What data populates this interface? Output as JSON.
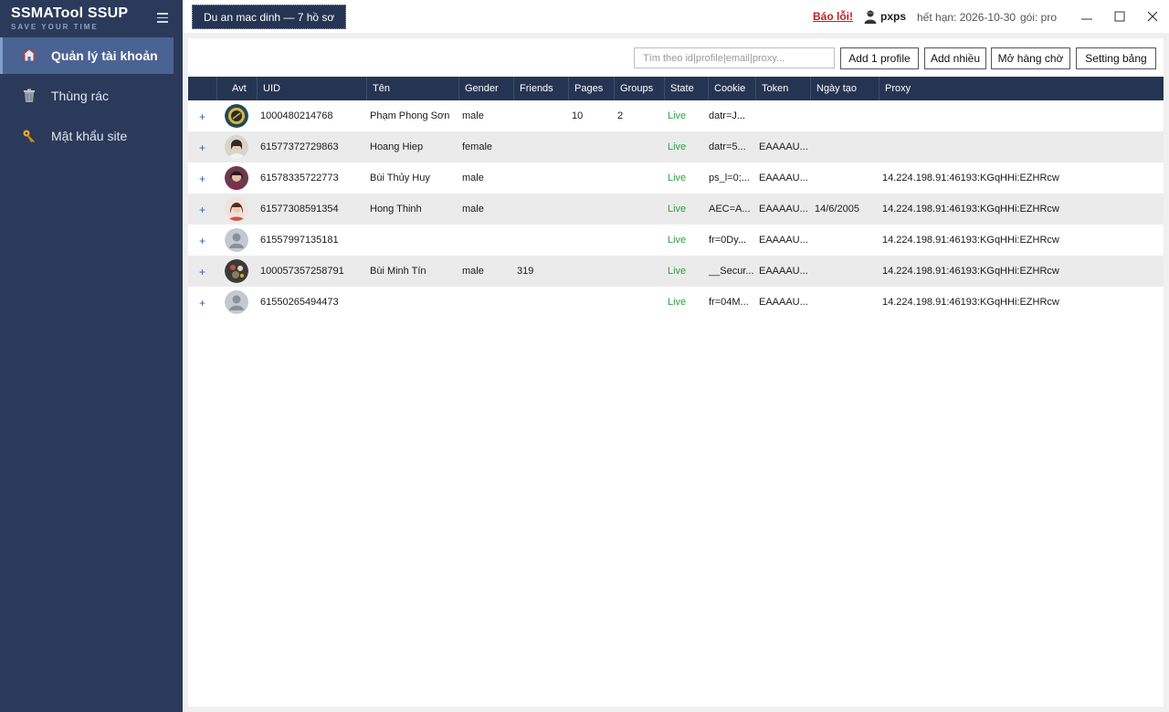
{
  "app": {
    "title": "SSMATool SSUP",
    "subtitle": "SAVE YOUR TIME"
  },
  "sidebar": {
    "items": [
      {
        "label": "Quản lý tài khoản",
        "icon": "home-icon",
        "active": true
      },
      {
        "label": "Thùng rác",
        "icon": "trash-icon",
        "active": false
      },
      {
        "label": "Mật khẩu site",
        "icon": "key-icon",
        "active": false
      }
    ]
  },
  "topbar": {
    "project_tab": "Du an mac dinh — 7 hồ sơ",
    "report_label": "Báo lỗi!",
    "username": "pxps",
    "expire": "hết hạn: 2026-10-30",
    "plan": "gói: pro"
  },
  "toolbar": {
    "search_placeholder": "Tìm theo id|profile|email|proxy...",
    "add_one": "Add 1 profile",
    "add_many": "Add nhiều",
    "open_queue": "Mở hàng chờ",
    "table_settings": "Setting bảng"
  },
  "table": {
    "columns": [
      "",
      "Avt",
      "UID",
      "Tên",
      "Gender",
      "Friends",
      "Pages",
      "Groups",
      "State",
      "Cookie",
      "Token",
      "Ngày tạo",
      "Proxy"
    ],
    "expand_symbol": "+",
    "rows": [
      {
        "uid": "1000480214768",
        "name": "Phạm Phong Sơn",
        "gender": "male",
        "friends": "",
        "pages": "10",
        "groups": "2",
        "state": "Live",
        "cookie": "datr=J...",
        "token": "",
        "created": "",
        "proxy": "",
        "avatar": "avatar-1"
      },
      {
        "uid": "61577372729863",
        "name": "Hoang Hiep",
        "gender": "female",
        "friends": "",
        "pages": "",
        "groups": "",
        "state": "Live",
        "cookie": "datr=5...",
        "token": "EAAAAU...",
        "created": "",
        "proxy": "",
        "avatar": "avatar-2"
      },
      {
        "uid": "61578335722773",
        "name": "Bùi Thủy Huy",
        "gender": "male",
        "friends": "",
        "pages": "",
        "groups": "",
        "state": "Live",
        "cookie": "ps_l=0;...",
        "token": "EAAAAU...",
        "created": "",
        "proxy": "14.224.198.91:46193:KGqHHi:EZHRcw",
        "avatar": "avatar-3"
      },
      {
        "uid": "61577308591354",
        "name": "Hong Thinh",
        "gender": "male",
        "friends": "",
        "pages": "",
        "groups": "",
        "state": "Live",
        "cookie": "AEC=A...",
        "token": "EAAAAU...",
        "created": "14/6/2005",
        "proxy": "14.224.198.91:46193:KGqHHi:EZHRcw",
        "avatar": "avatar-4"
      },
      {
        "uid": "61557997135181",
        "name": "",
        "gender": "",
        "friends": "",
        "pages": "",
        "groups": "",
        "state": "Live",
        "cookie": "fr=0Dy...",
        "token": "EAAAAU...",
        "created": "",
        "proxy": "14.224.198.91:46193:KGqHHi:EZHRcw",
        "avatar": "default-avatar"
      },
      {
        "uid": "100057357258791",
        "name": "Bùi Minh Tín",
        "gender": "male",
        "friends": "319",
        "pages": "",
        "groups": "",
        "state": "Live",
        "cookie": "__Secur...",
        "token": "EAAAAU...",
        "created": "",
        "proxy": "14.224.198.91:46193:KGqHHi:EZHRcw",
        "avatar": "avatar-6"
      },
      {
        "uid": "61550265494473",
        "name": "",
        "gender": "",
        "friends": "",
        "pages": "",
        "groups": "",
        "state": "Live",
        "cookie": "fr=04M...",
        "token": "EAAAAU...",
        "created": "",
        "proxy": "14.224.198.91:46193:KGqHHi:EZHRcw",
        "avatar": "default-avatar"
      }
    ]
  },
  "colors": {
    "sidebar_bg": "#2b3a5a",
    "sidebar_active": "#4a6392",
    "header_bg": "#243452",
    "live": "#2ea043",
    "report": "#c0201c"
  }
}
